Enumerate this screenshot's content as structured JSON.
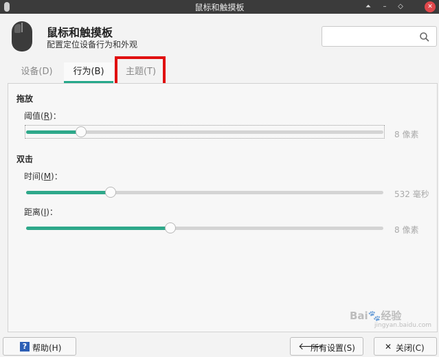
{
  "window": {
    "title": "鼠标和触摸板",
    "buttons": {
      "shade": "⏶",
      "minimize": "–",
      "maximize": "◇",
      "close": "✕"
    }
  },
  "header": {
    "title": "鼠标和触摸板",
    "subtitle": "配置定位设备行为和外观",
    "search_placeholder": ""
  },
  "tabs": [
    {
      "label": "设备(D)",
      "active": false
    },
    {
      "label": "行为(B)",
      "active": true
    },
    {
      "label": "主题(T)",
      "active": false
    }
  ],
  "drag": {
    "heading": "拖放",
    "threshold": {
      "label_prefix": "阈值(",
      "mnemonic": "R",
      "label_suffix": ")：",
      "value": 8,
      "range": [
        1,
        50
      ],
      "unit_text": "8 像素"
    }
  },
  "double_click": {
    "heading": "双击",
    "time": {
      "label_prefix": "时间(",
      "mnemonic": "M",
      "label_suffix": ")：",
      "value": 532,
      "range": [
        100,
        2000
      ],
      "unit_text": "532 毫秒"
    },
    "distance": {
      "label_prefix": "距离(",
      "mnemonic": "I",
      "label_suffix": ")：",
      "value": 8,
      "range": [
        0,
        20
      ],
      "unit_text": "8 像素"
    }
  },
  "footer": {
    "help": {
      "icon": "?",
      "label": "帮助(H)"
    },
    "all_settings": {
      "icon": "🡐",
      "label": "所有设置(S)"
    },
    "close": {
      "icon": "✕",
      "label": "关闭(C)"
    }
  },
  "watermark": {
    "brand": "Bai🐾经验",
    "url": "jingyan.baidu.com"
  },
  "colors": {
    "accent": "#2ea88a",
    "titlebar": "#3b3b3b",
    "highlight": "#e00e0e",
    "close": "#e0474b"
  }
}
